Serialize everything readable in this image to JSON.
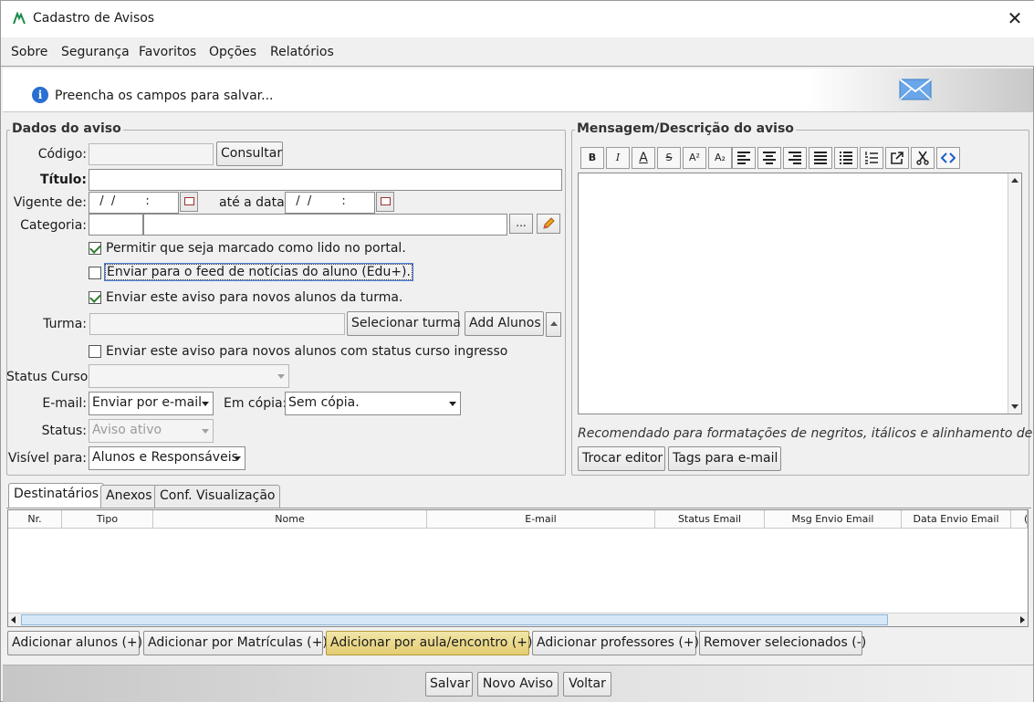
{
  "window": {
    "title": "Cadastro de Avisos",
    "close_glyph": "✕"
  },
  "menu": {
    "sobre": "Sobre",
    "seguranca": "Segurança",
    "favoritos": "Favoritos",
    "opcoes": "Opções",
    "relatorios": "Relatórios"
  },
  "info": {
    "icon_glyph": "i",
    "message": "Preencha os campos para salvar..."
  },
  "dados": {
    "legend": "Dados do aviso",
    "codigo_label": "Código:",
    "consultar_label": "Consultar",
    "titulo_label": "Título:",
    "vigente_label": "Vigente de:",
    "vigente_value": "  /  /        :",
    "ate_label": "até a data:",
    "ate_value": "  /  /        :",
    "categoria_label": "Categoria:",
    "ellipsis": "...",
    "check_lido": "Permitir que seja marcado como lido no portal.",
    "check_feed": "Enviar para o feed de notícias do aluno (Edu+).",
    "check_novos_turma": "Enviar este aviso para novos alunos da turma.",
    "turma_label": "Turma:",
    "selecionar_turma": "Selecionar turma",
    "add_alunos": "Add Alunos",
    "check_status_ingresso": "Enviar este aviso para novos alunos com status curso ingresso",
    "status_curso_label": "Status Curso:",
    "email_label": "E-mail:",
    "email_value": "Enviar por e-mail",
    "em_copia_label": "Em cópia:",
    "em_copia_value": "Sem cópia.",
    "status_label": "Status:",
    "status_value": "Aviso ativo",
    "visivel_label": "Visível para:",
    "visivel_value": "Alunos e Responsáveis"
  },
  "mensagem": {
    "legend": "Mensagem/Descrição do aviso",
    "toolbar": [
      "B",
      "I",
      "A",
      "S",
      "A²",
      "A₂"
    ],
    "hint": "Recomendado para formatações de negritos, itálicos e alinhamento de texto.",
    "trocar_editor": "Trocar editor",
    "tags_email": "Tags para e-mail"
  },
  "tabs": [
    "Destinatários",
    "Anexos",
    "Conf. Visualização"
  ],
  "grid": {
    "columns": [
      "Nr.",
      "Tipo",
      "Nome",
      "E-mail",
      "Status Email",
      "Msg Envio Email",
      "Data Envio Email",
      "("
    ]
  },
  "actions": {
    "adicionar_alunos": "Adicionar alunos (+)",
    "adicionar_matriculas": "Adicionar por Matrículas (+)",
    "adicionar_aula": "Adicionar por aula/encontro (+)",
    "adicionar_professores": "Adicionar professores (+)",
    "remover_selecionados": "Remover selecionados (-)"
  },
  "footer": {
    "salvar": "Salvar",
    "novo_aviso": "Novo Aviso",
    "voltar": "Voltar"
  }
}
